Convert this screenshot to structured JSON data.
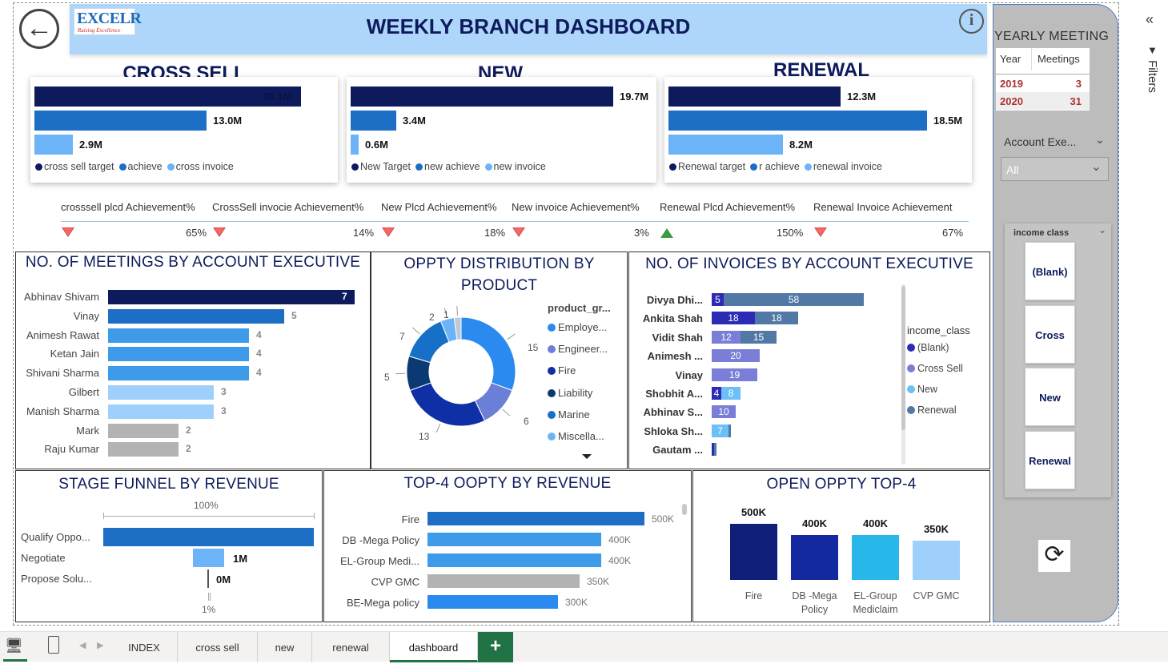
{
  "header": {
    "title": "WEEKLY BRANCH DASHBOARD",
    "logo_text": "EXCELR",
    "logo_tagline": "Raising Excellence",
    "info": "i"
  },
  "kpi_cards": [
    {
      "title": "CROSS SELL",
      "bars": [
        {
          "label": "20.1M",
          "value": 20.1,
          "color": "#0d1b5c"
        },
        {
          "label": "13.0M",
          "value": 13.0,
          "color": "#1d6fc6"
        },
        {
          "label": "2.9M",
          "value": 2.9,
          "color": "#6cb4f7"
        }
      ],
      "legend": [
        "cross sell target",
        "achieve",
        "cross invoice"
      ]
    },
    {
      "title": "NEW",
      "bars": [
        {
          "label": "19.7M",
          "value": 19.7,
          "color": "#0d1b5c"
        },
        {
          "label": "3.4M",
          "value": 3.4,
          "color": "#1d6fc6"
        },
        {
          "label": "0.6M",
          "value": 0.6,
          "color": "#6cb4f7"
        }
      ],
      "legend": [
        "New Target",
        "new achieve",
        "new invoice"
      ]
    },
    {
      "title": "RENEWAL",
      "bars": [
        {
          "label": "12.3M",
          "value": 12.3,
          "color": "#0d1b5c"
        },
        {
          "label": "18.5M",
          "value": 18.5,
          "color": "#1d6fc6"
        },
        {
          "label": "8.2M",
          "value": 8.2,
          "color": "#6cb4f7"
        }
      ],
      "legend": [
        "Renewal target",
        "r achieve",
        "renewal invoice"
      ]
    }
  ],
  "achievements": [
    {
      "label": "crosssell plcd Achievement%",
      "value": "65%",
      "status": "down"
    },
    {
      "label": "CrossSell invocie Achievement%",
      "value": "14%",
      "status": "down"
    },
    {
      "label": "New Plcd Achievement%",
      "value": "18%",
      "status": "down"
    },
    {
      "label": "New invoice Achievement%",
      "value": "3%",
      "status": "down"
    },
    {
      "label": "Renewal Plcd Achievement%",
      "value": "150%",
      "status": "up"
    },
    {
      "label": "Renewal Invoice Achievement",
      "value": "67%",
      "status": "down"
    }
  ],
  "meetings_panel": {
    "title": "NO. OF MEETINGS BY ACCOUNT EXECUTIVE",
    "rows": [
      {
        "name": "Abhinav Shivam",
        "value": 7,
        "color": "#0d1b5c"
      },
      {
        "name": "Vinay",
        "value": 5,
        "color": "#1d6fc6"
      },
      {
        "name": "Animesh Rawat",
        "value": 4,
        "color": "#3d9be9"
      },
      {
        "name": "Ketan Jain",
        "value": 4,
        "color": "#3d9be9"
      },
      {
        "name": "Shivani Sharma",
        "value": 4,
        "color": "#3d9be9"
      },
      {
        "name": "Gilbert",
        "value": 3,
        "color": "#9fd0fb"
      },
      {
        "name": "Manish Sharma",
        "value": 3,
        "color": "#9fd0fb"
      },
      {
        "name": "Mark",
        "value": 2,
        "color": "#b3b3b3"
      },
      {
        "name": "Raju Kumar",
        "value": 2,
        "color": "#b3b3b3"
      }
    ]
  },
  "oppty_panel": {
    "title_line1": "OPPTY DISTRIBUTION BY",
    "title_line2": "PRODUCT",
    "legend_title": "product_gr...",
    "legend": [
      {
        "name": "Employe...",
        "color": "#2a8af0"
      },
      {
        "name": "Engineer...",
        "color": "#6b7fd6"
      },
      {
        "name": "Fire",
        "color": "#0f2fa6"
      },
      {
        "name": "Liability",
        "color": "#0b3a73"
      },
      {
        "name": "Marine",
        "color": "#1670c8"
      },
      {
        "name": "Miscella...",
        "color": "#6cb4f7"
      }
    ],
    "slices": [
      {
        "label": "15",
        "value": 15,
        "color": "#2a8af0"
      },
      {
        "label": "6",
        "value": 6,
        "color": "#6b7fd6"
      },
      {
        "label": "13",
        "value": 13,
        "color": "#0f2fa6"
      },
      {
        "label": "5",
        "value": 5,
        "color": "#0b3a73"
      },
      {
        "label": "7",
        "value": 7,
        "color": "#1670c8"
      },
      {
        "label": "2",
        "value": 2,
        "color": "#6cb4f7"
      },
      {
        "label": "1",
        "value": 1,
        "color": "#c0c8d8"
      }
    ]
  },
  "invoices_panel": {
    "title": "NO. OF INVOICES BY ACCOUNT EXECUTIVE",
    "legend_title": "income_class",
    "legend": [
      {
        "name": "(Blank)",
        "color": "#2b2bb5"
      },
      {
        "name": "Cross Sell",
        "color": "#7a7ed6"
      },
      {
        "name": "New",
        "color": "#6cc0f7"
      },
      {
        "name": "Renewal",
        "color": "#5279a6"
      }
    ],
    "rows": [
      {
        "name": "Divya Dhi...",
        "segs": [
          {
            "v": 5,
            "label": "5",
            "c": "#2b2bb5"
          },
          {
            "v": 58,
            "label": "58",
            "c": "#5279a6"
          }
        ]
      },
      {
        "name": "Ankita Shah",
        "segs": [
          {
            "v": 18,
            "label": "18",
            "c": "#2b2bb5"
          },
          {
            "v": 18,
            "label": "18",
            "c": "#5279a6"
          }
        ]
      },
      {
        "name": "Vidit Shah",
        "segs": [
          {
            "v": 12,
            "label": "12",
            "c": "#7a7ed6"
          },
          {
            "v": 15,
            "label": "15",
            "c": "#5279a6"
          }
        ]
      },
      {
        "name": "Animesh ...",
        "segs": [
          {
            "v": 20,
            "label": "20",
            "c": "#7a7ed6"
          }
        ]
      },
      {
        "name": "Vinay",
        "segs": [
          {
            "v": 19,
            "label": "19",
            "c": "#7a7ed6"
          }
        ]
      },
      {
        "name": "Shobhit A...",
        "segs": [
          {
            "v": 4,
            "label": "4",
            "c": "#2b2bb5"
          },
          {
            "v": 8,
            "label": "8",
            "c": "#6cc0f7"
          }
        ]
      },
      {
        "name": "Abhinav S...",
        "segs": [
          {
            "v": 10,
            "label": "10",
            "c": "#7a7ed6"
          }
        ]
      },
      {
        "name": "Shloka Sh...",
        "segs": [
          {
            "v": 7,
            "label": "7",
            "c": "#6cc0f7"
          },
          {
            "v": 1,
            "label": "",
            "c": "#5279a6"
          }
        ]
      },
      {
        "name": "Gautam ...",
        "segs": [
          {
            "v": 1,
            "label": "",
            "c": "#2b2bb5"
          },
          {
            "v": 1,
            "label": "",
            "c": "#5279a6"
          }
        ]
      }
    ]
  },
  "funnel_panel": {
    "title": "STAGE FUNNEL BY REVENUE",
    "top_pct": "100%",
    "bottom_pct": "1%",
    "rows": [
      {
        "name": "Qualify Oppo...",
        "value": 100,
        "label": ""
      },
      {
        "name": "Negotiate",
        "value": 15,
        "label": "1M"
      },
      {
        "name": "Propose Solu...",
        "value": 1,
        "label": "0M"
      }
    ]
  },
  "top4_panel": {
    "title": "TOP-4 OOPTY BY REVENUE",
    "rows": [
      {
        "name": "Fire",
        "value": 500,
        "label": "500K",
        "color": "#1d6fc6"
      },
      {
        "name": "DB -Mega Policy",
        "value": 400,
        "label": "400K",
        "color": "#3d9be9"
      },
      {
        "name": "EL-Group Medi...",
        "value": 400,
        "label": "400K",
        "color": "#3d9be9"
      },
      {
        "name": "CVP GMC",
        "value": 350,
        "label": "350K",
        "color": "#b3b3b3"
      },
      {
        "name": "BE-Mega policy",
        "value": 300,
        "label": "300K",
        "color": "#2a8af0"
      }
    ]
  },
  "open_panel": {
    "title": "OPEN OPPTY TOP-4",
    "cols": [
      {
        "name": "Fire",
        "name2": "",
        "value": 500,
        "label": "500K",
        "color": "#0f1f7a"
      },
      {
        "name": "DB -Mega",
        "name2": "Policy",
        "value": 400,
        "label": "400K",
        "color": "#1428a0"
      },
      {
        "name": "EL-Group",
        "name2": "Mediclaim",
        "value": 400,
        "label": "400K",
        "color": "#29b6e8"
      },
      {
        "name": "CVP GMC",
        "name2": "",
        "value": 350,
        "label": "350K",
        "color": "#9fd0fb"
      }
    ]
  },
  "sidebar": {
    "meeting_title": "YEARLY MEETING",
    "table_headers": [
      "Year",
      "Meetings"
    ],
    "table_rows": [
      [
        "2019",
        "3"
      ],
      [
        "2020",
        "31"
      ]
    ],
    "account_label": "Account Exe...",
    "account_value": "All",
    "income_label": "income class",
    "income_options": [
      "(Blank)",
      "Cross Sell",
      "New",
      "Renewal"
    ]
  },
  "filters_label": "Filters",
  "tabs": [
    "INDEX",
    "cross sell",
    "new",
    "renewal",
    "dashboard"
  ],
  "active_tab": "dashboard",
  "chart_data": [
    {
      "type": "bar",
      "title": "NO. OF MEETINGS BY ACCOUNT EXECUTIVE",
      "categories": [
        "Abhinav Shivam",
        "Vinay",
        "Animesh Rawat",
        "Ketan Jain",
        "Shivani Sharma",
        "Gilbert",
        "Manish Sharma",
        "Mark",
        "Raju Kumar"
      ],
      "values": [
        7,
        5,
        4,
        4,
        4,
        3,
        3,
        2,
        2
      ]
    },
    {
      "type": "pie",
      "title": "OPPTY DISTRIBUTION BY PRODUCT",
      "categories": [
        "Employe...",
        "Engineer...",
        "Fire",
        "Liability",
        "Marine",
        "Miscella...",
        ""
      ],
      "values": [
        15,
        6,
        13,
        5,
        7,
        2,
        1
      ]
    },
    {
      "type": "bar",
      "title": "TOP-4 OOPTY BY REVENUE",
      "categories": [
        "Fire",
        "DB -Mega Policy",
        "EL-Group Medi...",
        "CVP GMC",
        "BE-Mega policy"
      ],
      "values": [
        500,
        400,
        400,
        350,
        300
      ]
    },
    {
      "type": "bar",
      "title": "OPEN OPPTY TOP-4",
      "categories": [
        "Fire",
        "DB -Mega Policy",
        "EL-Group Mediclaim",
        "CVP GMC"
      ],
      "values": [
        500,
        400,
        400,
        350
      ]
    }
  ]
}
